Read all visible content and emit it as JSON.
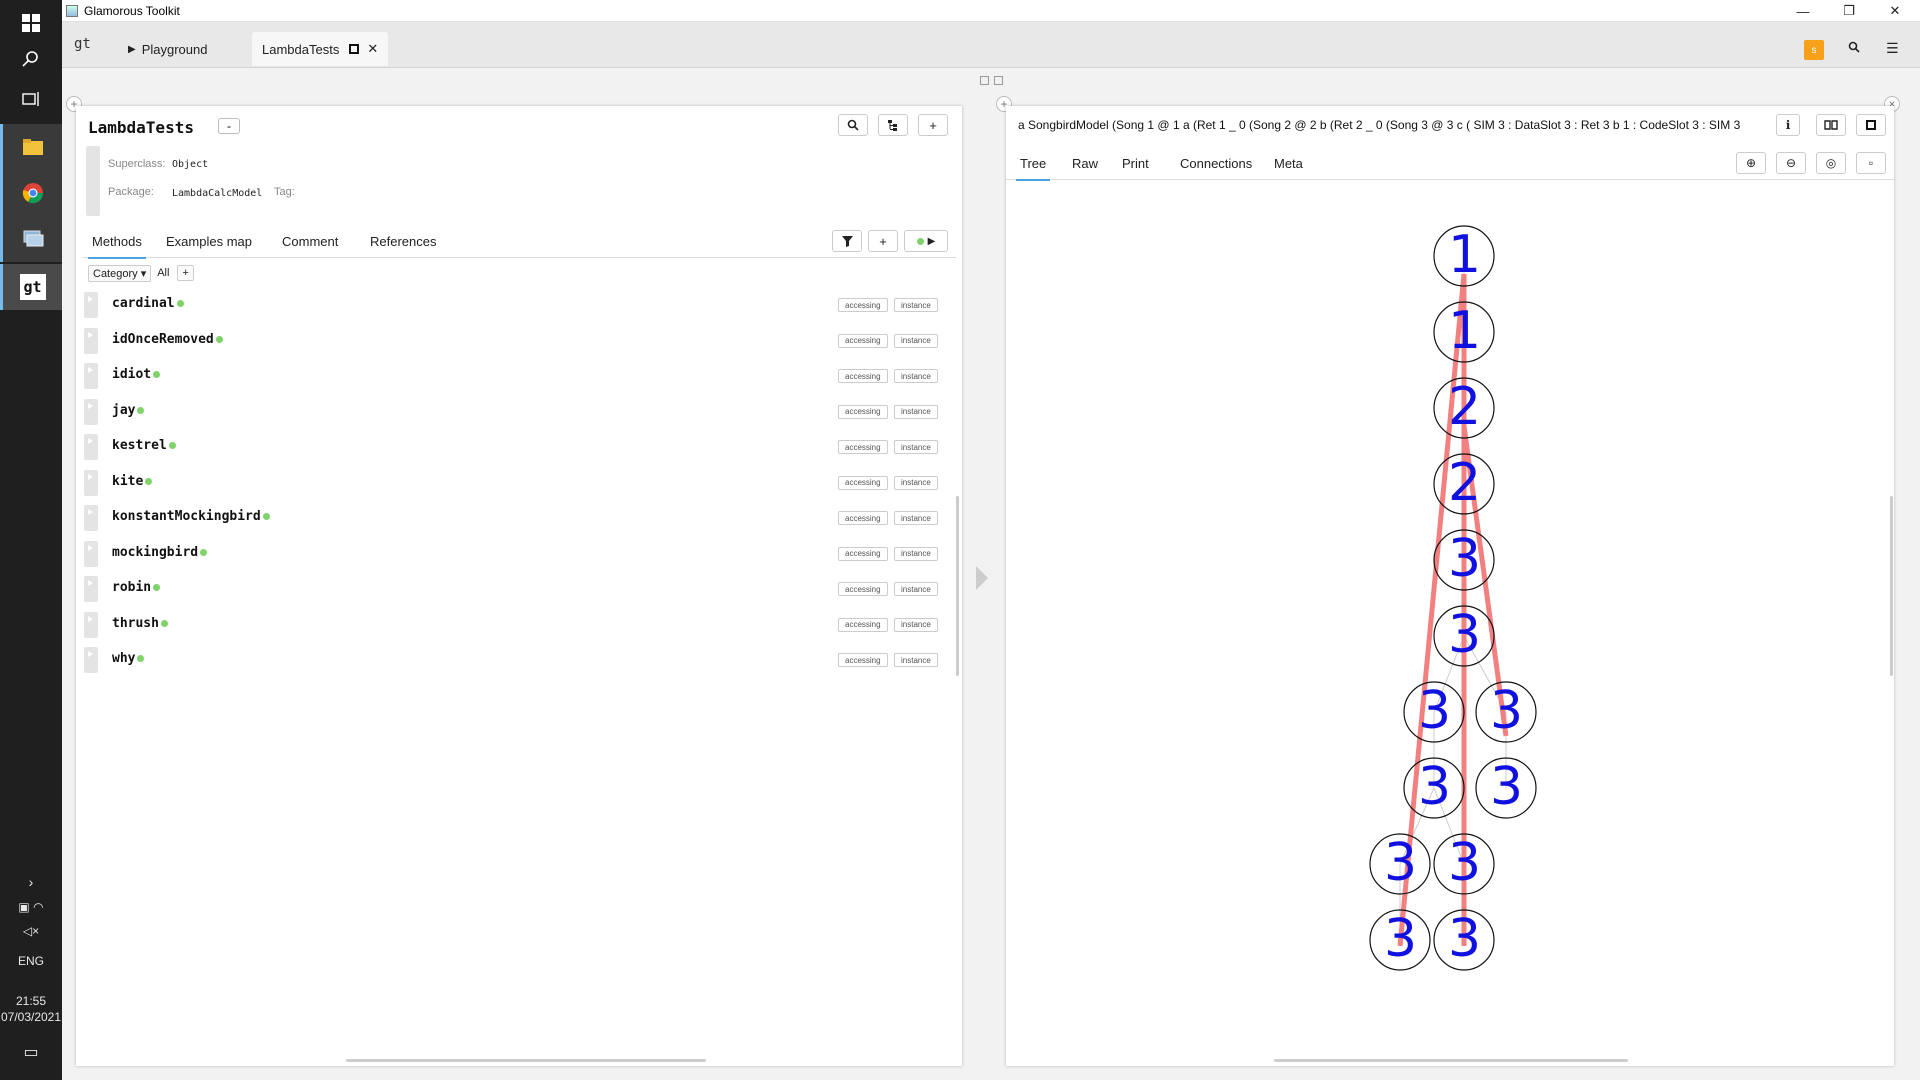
{
  "window": {
    "title": "Glamorous Toolkit"
  },
  "tabs": [
    {
      "label": "Playground"
    },
    {
      "label": "LambdaTests"
    }
  ],
  "logo": "gt",
  "badge": "s",
  "taskbar": {
    "lang": "ENG",
    "time": "21:55",
    "date": "07/03/2021"
  },
  "left": {
    "class_name": "LambdaTests",
    "superclass_label": "Superclass:",
    "superclass": "Object",
    "package_label": "Package:",
    "package": "LambdaCalcModel",
    "tag_label": "Tag:",
    "subtabs": [
      "Methods",
      "Examples map",
      "Comment",
      "References"
    ],
    "filter": {
      "category": "Category",
      "all": "All"
    },
    "methods": [
      {
        "name": "cardinal",
        "tag1": "accessing",
        "tag2": "instance"
      },
      {
        "name": "idOnceRemoved",
        "tag1": "accessing",
        "tag2": "instance"
      },
      {
        "name": "idiot",
        "tag1": "accessing",
        "tag2": "instance"
      },
      {
        "name": "jay",
        "tag1": "accessing",
        "tag2": "instance"
      },
      {
        "name": "kestrel",
        "tag1": "accessing",
        "tag2": "instance"
      },
      {
        "name": "kite",
        "tag1": "accessing",
        "tag2": "instance"
      },
      {
        "name": "konstantMockingbird",
        "tag1": "accessing",
        "tag2": "instance"
      },
      {
        "name": "mockingbird",
        "tag1": "accessing",
        "tag2": "instance"
      },
      {
        "name": "robin",
        "tag1": "accessing",
        "tag2": "instance"
      },
      {
        "name": "thrush",
        "tag1": "accessing",
        "tag2": "instance"
      },
      {
        "name": "why",
        "tag1": "accessing",
        "tag2": "instance"
      }
    ]
  },
  "right": {
    "title": "a SongbirdModel (Song 1 @ 1 a (Ret 1 _ 0  (Song 2 @ 2 b (Ret 2 _ 0  (Song 3 @ 3 c ( SIM 3 :  DataSlot 3 : Ret 3 b 1  :  CodeSlot 3 :  SIM 3",
    "tabs": [
      "Tree",
      "Raw",
      "Print",
      "Connections",
      "Meta"
    ],
    "tree_nodes": [
      "1",
      "1",
      "2",
      "2",
      "3",
      "3",
      "3",
      "3",
      "3",
      "3",
      "3",
      "3",
      "3",
      "3"
    ],
    "colors": {
      "node_text": "#1010e0",
      "highlight": "#f28080"
    }
  }
}
